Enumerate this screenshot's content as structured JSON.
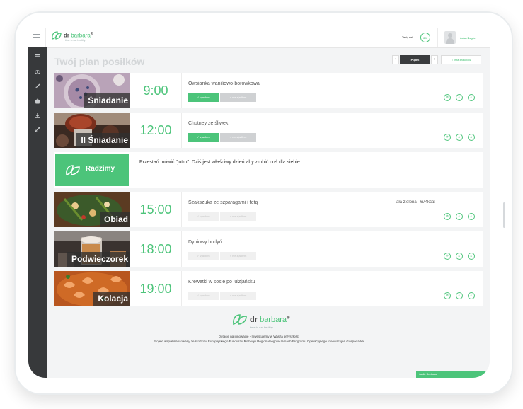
{
  "header": {
    "logo_dr": "dr",
    "logo_name": "barbara",
    "logo_reg": "®",
    "logo_tagline": "time to eat healthy",
    "goal_label": "Twój cel",
    "goal_value": "0%",
    "user_name": "John Doyle"
  },
  "page": {
    "title": "Twój plan posiłków",
    "prev_label": "‹",
    "day_label": "Piątek",
    "next_label": "›",
    "shopping_list_label": "lista zakupów"
  },
  "meals": [
    {
      "name": "Śniadanie",
      "time": "9:00",
      "dish": "Owsianka waniliowo-borówkowa",
      "extra": "",
      "eaten_label": "zjadłem",
      "not_eaten_label": "nie zjadłem",
      "active": true
    },
    {
      "name": "II Śniadanie",
      "time": "12:00",
      "dish": "Chutney ze śliwek",
      "extra": "",
      "eaten_label": "zjadłem",
      "not_eaten_label": "nie zjadłem",
      "active": true
    },
    {
      "name": "Obiad",
      "time": "15:00",
      "dish": "Szakszuka ze szparagami i fetą",
      "extra": "ała zielona - 674kcal",
      "eaten_label": "zjadłem",
      "not_eaten_label": "nie zjadłem",
      "active": false
    },
    {
      "name": "Podwieczorek",
      "time": "18:00",
      "dish": "Dyniowy budyń",
      "extra": "",
      "eaten_label": "zjadłem",
      "not_eaten_label": "nie zjadłem",
      "active": false
    },
    {
      "name": "Kolacja",
      "time": "19:00",
      "dish": "Krewetki w sosie po luizjańsku",
      "extra": "",
      "eaten_label": "zjadłem",
      "not_eaten_label": "nie zjadłem",
      "active": false
    }
  ],
  "tip": {
    "label": "Radzimy",
    "text": "Przestań mówić \"jutro\". Dziś jest właściwy dzień aby zrobić coś dla siebie."
  },
  "footer": {
    "line1": "Dotacje na innowacje - Inwestujemy w Waszą przyszłość.",
    "line2": "Projekt współfinansowany ze środków Europejskiego Funduszu Rozwoju Regionalnego w ramach Programu Operacyjnego Innowacyjna Gospodarka.",
    "bottom_tab_label": "Jadłe Barbara"
  },
  "colors": {
    "accent": "#4cc47a",
    "sidebar": "#37393b",
    "background": "#f3f4f5"
  },
  "icons": {
    "sidebar": [
      "calendar-icon",
      "eye-icon",
      "brush-icon",
      "basket-icon",
      "download-icon",
      "expand-icon"
    ],
    "meal_actions": [
      "swap-icon",
      "basket-icon",
      "basket-icon"
    ]
  }
}
